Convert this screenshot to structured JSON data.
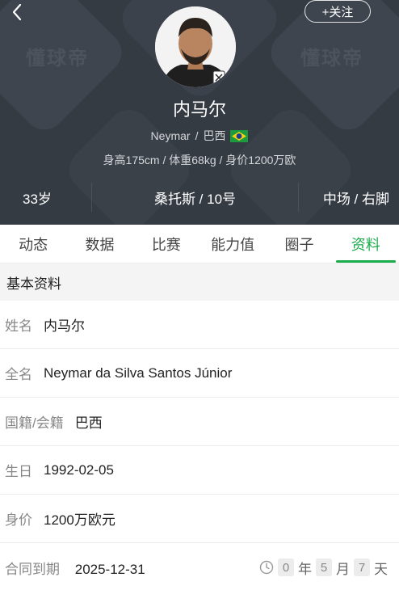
{
  "watermark": "懂球帝",
  "header": {
    "follow_label": "+关注",
    "name": "内马尔",
    "en_name": "Neymar",
    "separator": "/",
    "country": "巴西",
    "physical": "身高175cm / 体重68kg / 身价1200万欧",
    "age": "33岁",
    "club_number": "桑托斯 / 10号",
    "position": "中场 / 右脚"
  },
  "tabs": [
    {
      "label": "动态",
      "active": false
    },
    {
      "label": "数据",
      "active": false
    },
    {
      "label": "比赛",
      "active": false
    },
    {
      "label": "能力值",
      "active": false
    },
    {
      "label": "圈子",
      "active": false
    },
    {
      "label": "资料",
      "active": true
    }
  ],
  "section": {
    "title": "基本资料"
  },
  "profile": [
    {
      "label": "姓名",
      "value": "内马尔"
    },
    {
      "label": "全名",
      "value": "Neymar da Silva Santos Júnior"
    },
    {
      "label": "国籍/会籍",
      "value": "巴西"
    },
    {
      "label": "生日",
      "value": "1992-02-05"
    },
    {
      "label": "身价",
      "value": "1200万欧元"
    }
  ],
  "contract": {
    "label": "合同到期",
    "value": "2025-12-31",
    "countdown": {
      "years": "0",
      "year_unit": "年",
      "months": "5",
      "month_unit": "月",
      "days": "7",
      "day_unit": "天"
    }
  },
  "colors": {
    "accent": "#1aab4b",
    "header_bg": "#353b43"
  },
  "icons": {
    "back": "chevron-left-icon",
    "clock": "clock-icon",
    "flag": "brazil-flag-icon",
    "avatar": "player-avatar"
  }
}
